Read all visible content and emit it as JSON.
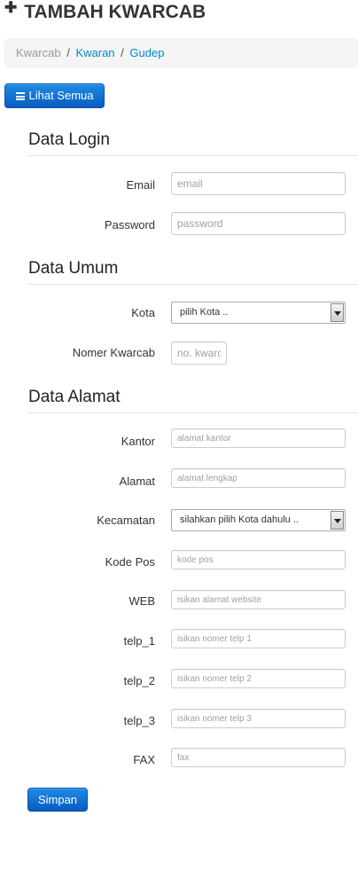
{
  "page": {
    "title": "TAMBAH KWARCAB",
    "title_icon": "plus-icon"
  },
  "breadcrumb": {
    "current": "Kwarcab",
    "separator": "/",
    "links": [
      "Kwaran",
      "Gudep"
    ]
  },
  "toolbar": {
    "list_button_label": "Lihat Semua",
    "list_button_icon": "list-icon"
  },
  "sections": {
    "login": {
      "heading": "Data Login",
      "email": {
        "label": "Email",
        "placeholder": "email"
      },
      "password": {
        "label": "Password",
        "placeholder": "password"
      }
    },
    "umum": {
      "heading": "Data Umum",
      "kota": {
        "label": "Kota",
        "selected": "pilih Kota .."
      },
      "nomer": {
        "label": "Nomer Kwarcab",
        "placeholder": "no. kwarcab"
      }
    },
    "alamat": {
      "heading": "Data Alamat",
      "kantor": {
        "label": "Kantor",
        "placeholder": "alamat kantor"
      },
      "alamat": {
        "label": "Alamat",
        "placeholder": "alamat lengkap"
      },
      "kecamatan": {
        "label": "Kecamatan",
        "selected": "silahkan pilih Kota dahulu .."
      },
      "kodepos": {
        "label": "Kode Pos",
        "placeholder": "kode pos"
      },
      "web": {
        "label": "WEB",
        "placeholder": "isikan alamat website"
      },
      "telp1": {
        "label": "telp_1",
        "placeholder": "isikan nomer telp 1"
      },
      "telp2": {
        "label": "telp_2",
        "placeholder": "isikan nomer telp 2"
      },
      "telp3": {
        "label": "telp_3",
        "placeholder": "isikan nomer telp 3"
      },
      "fax": {
        "label": "FAX",
        "placeholder": "fax"
      }
    }
  },
  "actions": {
    "submit_label": "Simpan"
  },
  "colors": {
    "primary_button": "#0a6fd6",
    "link": "#0088cc",
    "breadcrumb_bg": "#f5f5f5"
  }
}
